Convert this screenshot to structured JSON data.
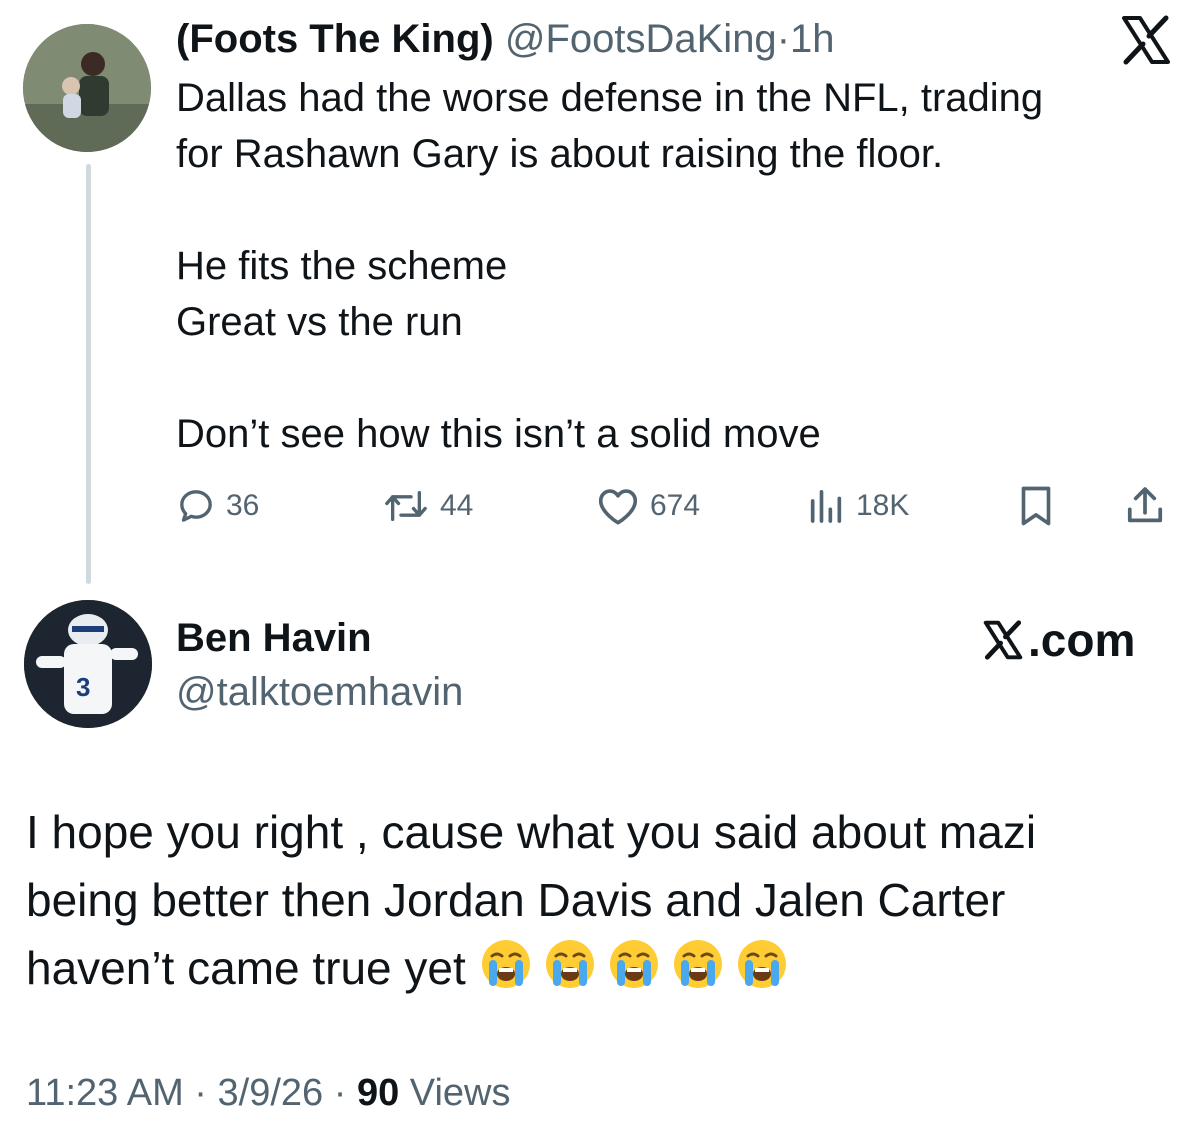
{
  "quoted_tweet": {
    "display_name": "(Foots The King)",
    "handle": "@FootsDaKing",
    "separator": "·",
    "time": "1h",
    "lines": [
      "Dallas had the worse defense in the NFL, trading",
      "for Rashawn Gary is about raising the floor.",
      "",
      "He fits the scheme",
      "Great vs the run",
      "",
      "Don’t see how this isn’t a solid move"
    ],
    "actions": {
      "replies": "36",
      "reposts": "44",
      "likes": "674",
      "views": "18K"
    },
    "icons": [
      "x-logo-icon",
      "reply-icon",
      "repost-icon",
      "like-icon",
      "views-icon",
      "bookmark-icon",
      "share-icon"
    ]
  },
  "reply_tweet": {
    "display_name": "Ben Havin",
    "handle": "@talktoemhavin",
    "brand_label": ".com",
    "lines": [
      "I hope you right , cause what you said about mazi",
      "being better then Jordan Davis and Jalen Carter",
      "haven’t came true yet"
    ],
    "emoji": [
      "loudly-crying-face",
      "loudly-crying-face",
      "loudly-crying-face",
      "loudly-crying-face",
      "loudly-crying-face"
    ],
    "meta": {
      "time": "11:23 AM",
      "separator": "·",
      "date": "3/9/26",
      "views_count": "90",
      "views_label": "Views"
    }
  },
  "colors": {
    "text_primary": "#0f1419",
    "text_secondary": "#536471",
    "thread_line": "#cfd9de",
    "background": "#ffffff"
  }
}
